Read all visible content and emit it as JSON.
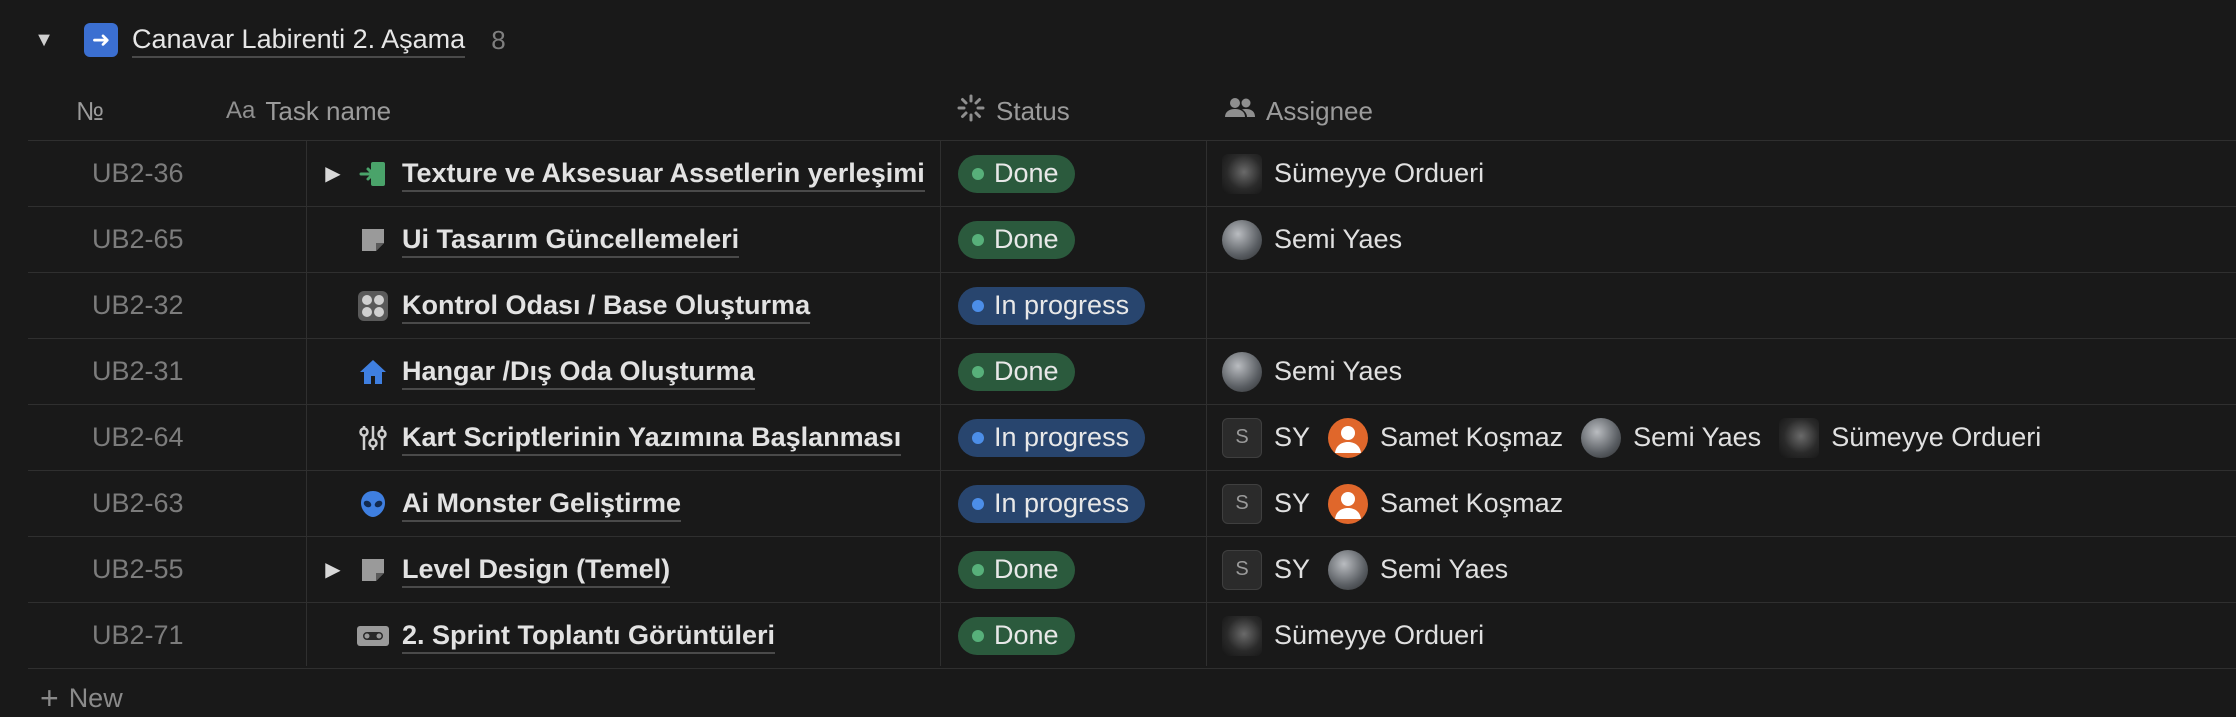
{
  "group": {
    "emoji": "➡️",
    "title": "Canavar Labirenti 2. Aşama",
    "count": "8"
  },
  "columns": {
    "id": {
      "label": "№"
    },
    "task": {
      "icon": "Aa",
      "label": "Task name"
    },
    "status": {
      "label": "Status"
    },
    "assignee": {
      "label": "Assignee"
    }
  },
  "rows": [
    {
      "id": "UB2-36",
      "expand": "▶",
      "icon": "exit-door-icon",
      "name": "Texture ve Aksesuar Assetlerin yerleşimi",
      "status": "Done",
      "assignees": [
        {
          "avatar": "photo-dark",
          "name": "Sümeyye Ordueri"
        }
      ]
    },
    {
      "id": "UB2-65",
      "expand": "",
      "icon": "note-icon",
      "name": "Ui Tasarım Güncellemeleri",
      "status": "Done",
      "assignees": [
        {
          "avatar": "photo-moon",
          "name": "Semi Yaes"
        }
      ]
    },
    {
      "id": "UB2-32",
      "expand": "",
      "icon": "control-panel-icon",
      "name": "Kontrol Odası / Base Oluşturma",
      "status": "In progress",
      "assignees": []
    },
    {
      "id": "UB2-31",
      "expand": "",
      "icon": "home-icon",
      "name": "Hangar /Dış Oda Oluşturma",
      "status": "Done",
      "assignees": [
        {
          "avatar": "photo-moon",
          "name": "Semi Yaes"
        }
      ]
    },
    {
      "id": "UB2-64",
      "expand": "",
      "icon": "sliders-icon",
      "name": "Kart Scriptlerinin Yazımına Başlanması",
      "status": "In progress",
      "assignees": [
        {
          "avatar": "letter-S",
          "name": "SY"
        },
        {
          "avatar": "person-orange",
          "name": "Samet Koşmaz"
        },
        {
          "avatar": "photo-moon",
          "name": "Semi Yaes"
        },
        {
          "avatar": "photo-dark",
          "name": "Sümeyye Ordueri"
        }
      ]
    },
    {
      "id": "UB2-63",
      "expand": "",
      "icon": "alien-icon",
      "name": "Ai Monster Geliştirme",
      "status": "In progress",
      "assignees": [
        {
          "avatar": "letter-S",
          "name": "SY"
        },
        {
          "avatar": "person-orange",
          "name": "Samet Koşmaz"
        }
      ]
    },
    {
      "id": "UB2-55",
      "expand": "▶",
      "icon": "note-icon",
      "name": "Level Design (Temel)",
      "status": "Done",
      "assignees": [
        {
          "avatar": "letter-S",
          "name": "SY"
        },
        {
          "avatar": "photo-moon",
          "name": "Semi Yaes"
        }
      ]
    },
    {
      "id": "UB2-71",
      "expand": "",
      "icon": "video-tape-icon",
      "name": "2. Sprint Toplantı Görüntüleri",
      "status": "Done",
      "assignees": [
        {
          "avatar": "photo-dark",
          "name": "Sümeyye Ordueri"
        }
      ]
    }
  ],
  "new_row": {
    "plus": "+",
    "label": "New"
  },
  "colors": {
    "background": "#191919",
    "done": "#2b5a3d",
    "in_progress": "#28456e"
  }
}
